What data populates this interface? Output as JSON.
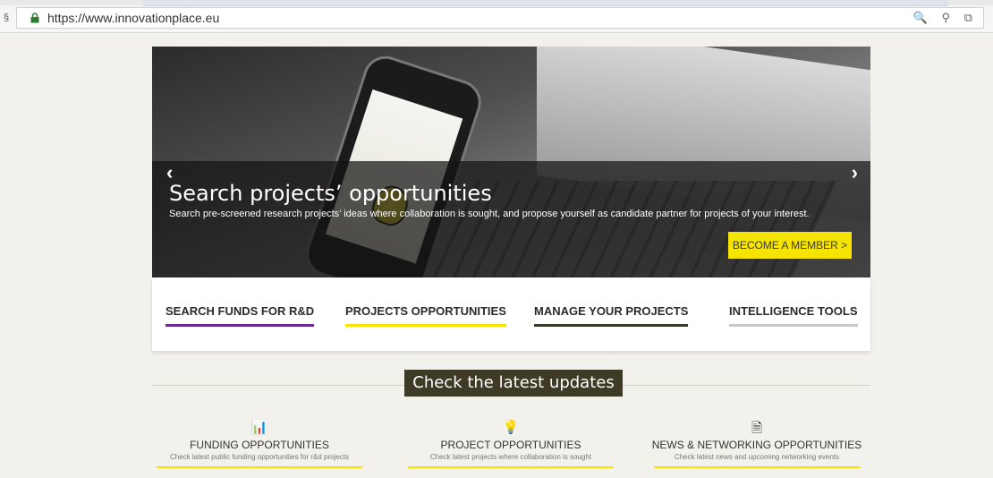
{
  "browser": {
    "url": "https://www.innovationplace.eu",
    "left_glyph": "§",
    "tools": "🔍 ⚲ ⧉"
  },
  "hero": {
    "title": "Search projects’ opportunities",
    "text": "Search pre-screened research projects’ ideas where collaboration is sought, and propose yourself as candidate partner for projects of your interest.",
    "cta": "BECOME A MEMBER >",
    "prev": "‹",
    "next": "›"
  },
  "tabs": [
    {
      "label": "SEARCH FUNDS FOR R&D",
      "color": "#6d2c8f"
    },
    {
      "label": "PROJECTS OPPORTUNITIES",
      "color": "#f5e300"
    },
    {
      "label": "MANAGE YOUR PROJECTS",
      "color": "#3b3b2b"
    },
    {
      "label": "INTELLIGENCE TOOLS",
      "color": "#c9c9c9"
    }
  ],
  "updates": {
    "title": "Check the latest updates",
    "columns": [
      {
        "icon": "chart-icon",
        "glyph": "📊",
        "title": "FUNDING OPPORTUNITIES",
        "subtitle": "Check latest public funding opportunities for r&d projects"
      },
      {
        "icon": "lightbulb-icon",
        "glyph": "💡",
        "title": "PROJECT OPPORTUNITIES",
        "subtitle": "Check latest projects where collaboration is sought"
      },
      {
        "icon": "document-icon",
        "glyph": "🗎",
        "title": "NEWS & NETWORKING OPPORTUNITIES",
        "subtitle": "Check latest news and upcoming networking events"
      }
    ]
  }
}
